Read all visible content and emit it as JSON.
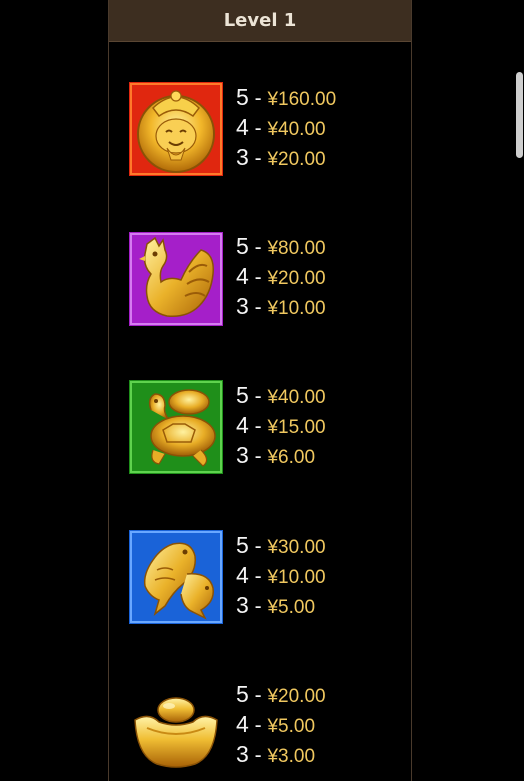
{
  "header": {
    "title": "Level 1"
  },
  "paytable": [
    {
      "symbol": "fortune-god-icon",
      "bg": "#e0270f",
      "pays": [
        {
          "count": "5",
          "amount": "¥160.00"
        },
        {
          "count": "4",
          "amount": "¥40.00"
        },
        {
          "count": "3",
          "amount": "¥20.00"
        }
      ]
    },
    {
      "symbol": "golden-rooster-icon",
      "bg": "#a51fc9",
      "pays": [
        {
          "count": "5",
          "amount": "¥80.00"
        },
        {
          "count": "4",
          "amount": "¥20.00"
        },
        {
          "count": "3",
          "amount": "¥10.00"
        }
      ]
    },
    {
      "symbol": "golden-turtle-icon",
      "bg": "#1f8f1a",
      "pays": [
        {
          "count": "5",
          "amount": "¥40.00"
        },
        {
          "count": "4",
          "amount": "¥15.00"
        },
        {
          "count": "3",
          "amount": "¥6.00"
        }
      ]
    },
    {
      "symbol": "golden-koi-fish-icon",
      "bg": "#1a63d8",
      "pays": [
        {
          "count": "5",
          "amount": "¥30.00"
        },
        {
          "count": "4",
          "amount": "¥10.00"
        },
        {
          "count": "3",
          "amount": "¥5.00"
        }
      ]
    },
    {
      "symbol": "gold-ingot-icon",
      "bg": "#000000",
      "pays": [
        {
          "count": "5",
          "amount": "¥20.00"
        },
        {
          "count": "4",
          "amount": "¥5.00"
        },
        {
          "count": "3",
          "amount": "¥3.00"
        }
      ]
    }
  ]
}
